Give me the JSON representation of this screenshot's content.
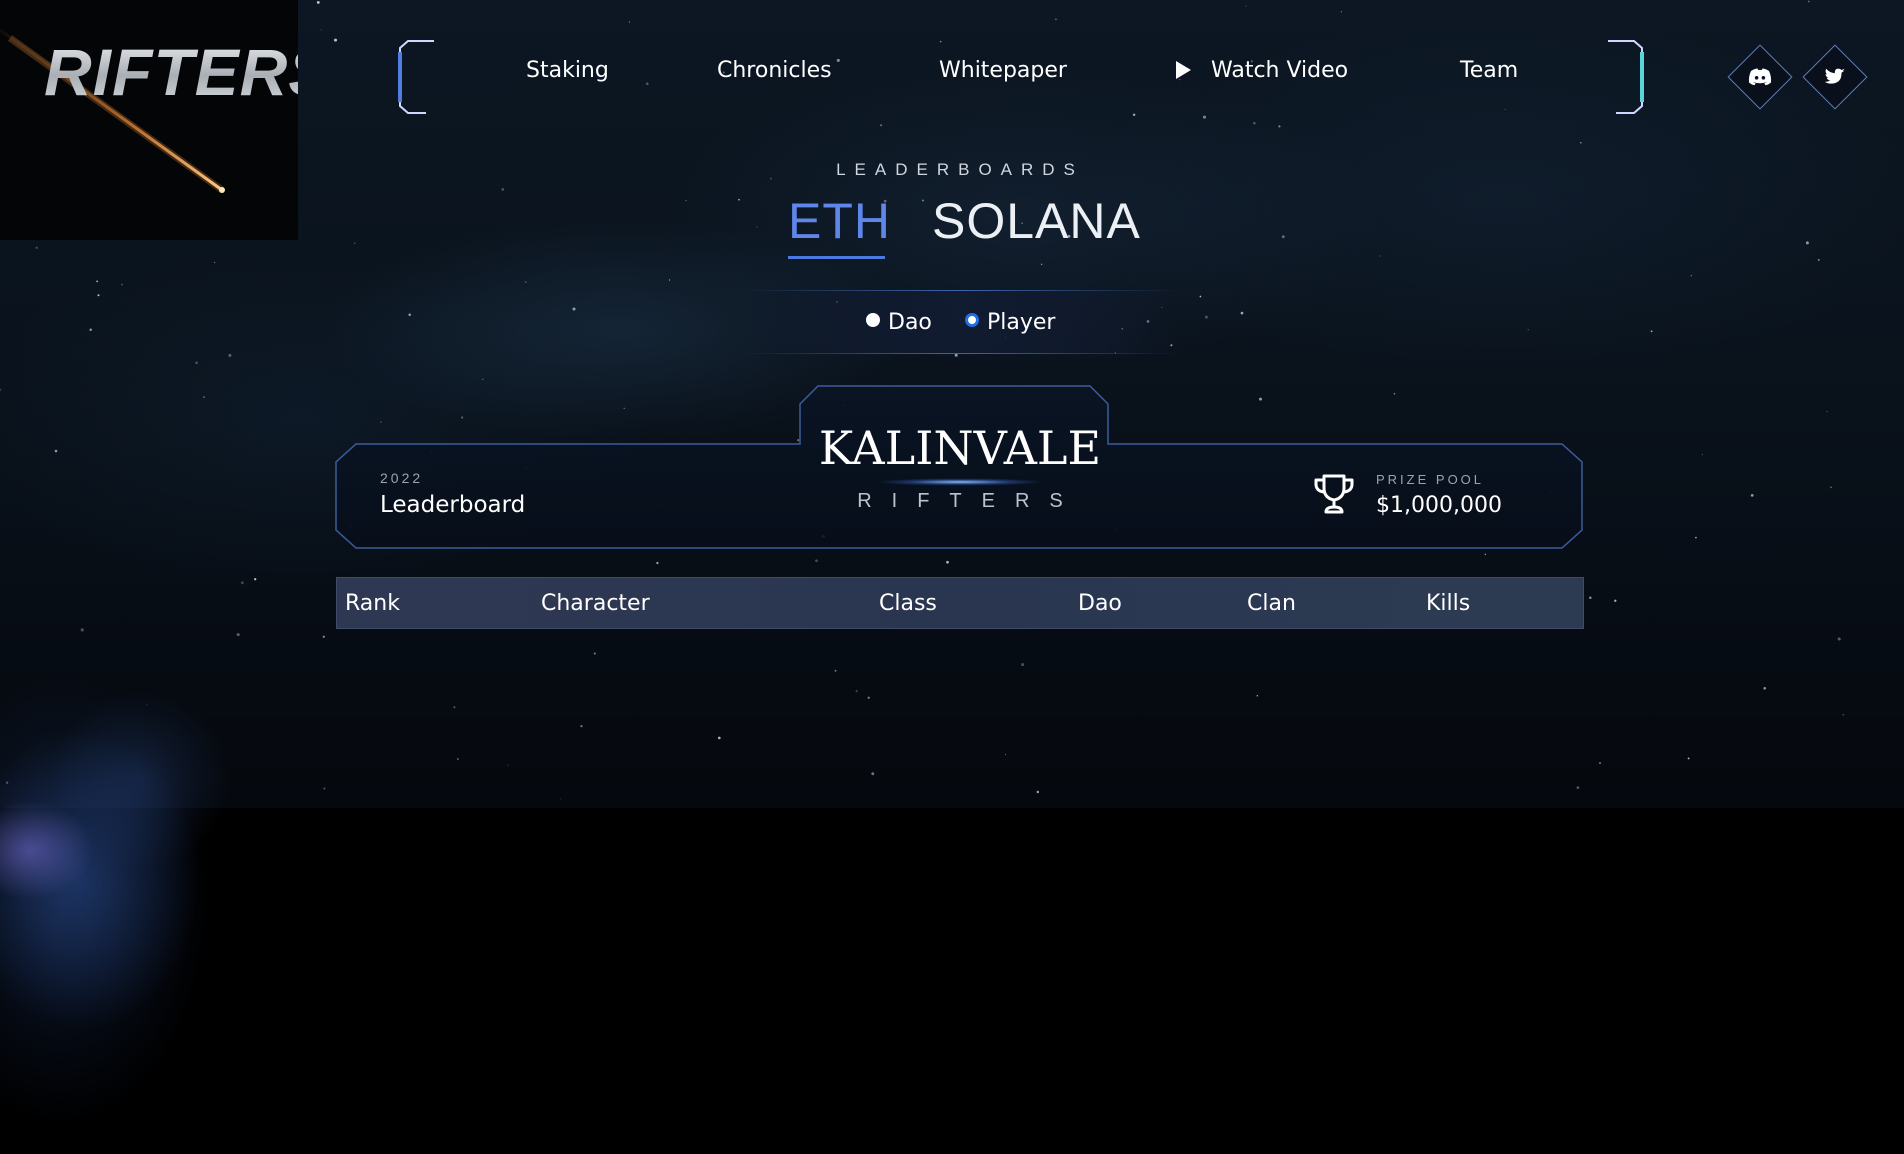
{
  "logo": {
    "text": "RIFTERS"
  },
  "nav": {
    "items": [
      {
        "label": "Staking"
      },
      {
        "label": "Chronicles"
      },
      {
        "label": "Whitepaper"
      },
      {
        "label": "Watch Video",
        "icon": "play-icon"
      },
      {
        "label": "Team"
      }
    ]
  },
  "social": [
    {
      "name": "discord",
      "icon": "discord-icon"
    },
    {
      "name": "twitter",
      "icon": "twitter-icon"
    }
  ],
  "leaderboards": {
    "heading": "LEADERBOARDS",
    "tabs": [
      {
        "label": "ETH",
        "active": true
      },
      {
        "label": "SOLANA",
        "active": false
      }
    ],
    "toggle": {
      "options": [
        {
          "label": "Dao",
          "checked": false
        },
        {
          "label": "Player",
          "checked": true
        }
      ]
    }
  },
  "panel": {
    "year": "2022",
    "title": "Leaderboard",
    "game_logo": {
      "main": "KALINVALE",
      "sub": "RIFTERS"
    },
    "prize_label": "PRIZE POOL",
    "prize_value": "$1,000,000",
    "trophy_icon": "trophy-icon"
  },
  "table": {
    "columns": [
      "Rank",
      "Character",
      "Class",
      "Dao",
      "Clan",
      "Kills"
    ],
    "rows": []
  },
  "colors": {
    "accent": "#5f86e8",
    "eth_underline": "#4a79e0",
    "radio_checked": "#1f6fe8",
    "panel_border": "#3c5c9c",
    "background": "#000000"
  }
}
